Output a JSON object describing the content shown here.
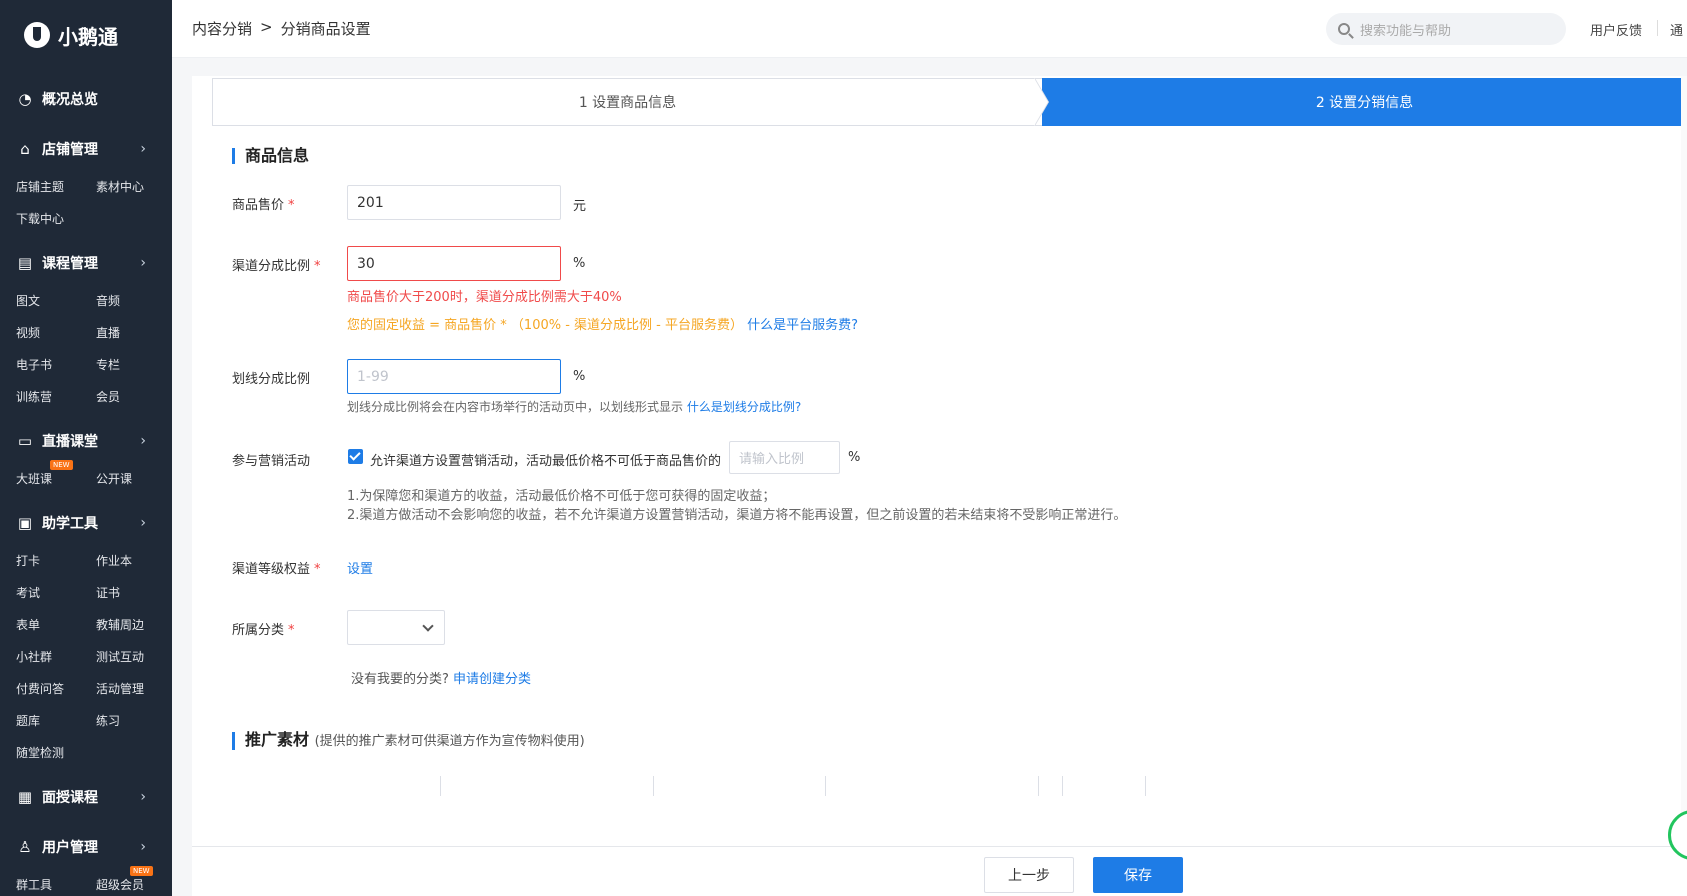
{
  "app": {
    "name": "小鹅通"
  },
  "sidebar": {
    "groups": [
      {
        "label": "概况总览",
        "icon": "pie-chart-icon",
        "items": []
      },
      {
        "label": "店铺管理",
        "icon": "store-icon",
        "items": [
          {
            "label": "店铺主题"
          },
          {
            "label": "素材中心"
          },
          {
            "label": "下载中心"
          }
        ]
      },
      {
        "label": "课程管理",
        "icon": "document-icon",
        "items": [
          {
            "label": "图文"
          },
          {
            "label": "音频"
          },
          {
            "label": "视频"
          },
          {
            "label": "直播"
          },
          {
            "label": "电子书"
          },
          {
            "label": "专栏"
          },
          {
            "label": "训练营"
          },
          {
            "label": "会员"
          }
        ]
      },
      {
        "label": "直播课堂",
        "icon": "video-icon",
        "items": [
          {
            "label": "大班课",
            "badge": "NEW"
          },
          {
            "label": "公开课"
          }
        ]
      },
      {
        "label": "助学工具",
        "icon": "toolbox-icon",
        "items": [
          {
            "label": "打卡"
          },
          {
            "label": "作业本"
          },
          {
            "label": "考试"
          },
          {
            "label": "证书"
          },
          {
            "label": "表单"
          },
          {
            "label": "教辅周边"
          },
          {
            "label": "小社群"
          },
          {
            "label": "测试互动"
          },
          {
            "label": "付费问答"
          },
          {
            "label": "活动管理"
          },
          {
            "label": "题库"
          },
          {
            "label": "练习"
          },
          {
            "label": "随堂检测"
          }
        ]
      },
      {
        "label": "面授课程",
        "icon": "classroom-icon",
        "items": []
      },
      {
        "label": "用户管理",
        "icon": "user-icon",
        "items": [
          {
            "label": "群工具"
          },
          {
            "label": "超级会员",
            "badge": "NEW"
          }
        ]
      }
    ]
  },
  "topbar": {
    "breadcrumb": [
      "内容分销",
      ">",
      "分销商品设置"
    ],
    "search_placeholder": "搜索功能与帮助",
    "feedback": "用户反馈",
    "more": "通"
  },
  "steps": [
    {
      "label": "1 设置商品信息",
      "active": false
    },
    {
      "label": "2 设置分销信息",
      "active": true
    }
  ],
  "section_goods": {
    "title": "商品信息"
  },
  "form": {
    "price": {
      "label": "商品售价",
      "value": "201",
      "unit": "元"
    },
    "ratio": {
      "label": "渠道分成比例",
      "value": "30",
      "unit": "%",
      "error": "商品售价大于200时，渠道分成比例需大于40%",
      "tip": "您的固定收益 = 商品售价 * （100% - 渠道分成比例 - 平台服务费）",
      "tip_link": "什么是平台服务费?"
    },
    "strike": {
      "label": "划线分成比例",
      "placeholder": "1-99",
      "unit": "%",
      "help": "划线分成比例将会在内容市场举行的活动页中，以划线形式显示",
      "help_link": "什么是划线分成比例?"
    },
    "marketing": {
      "label": "参与营销活动",
      "checkbox_label": "允许渠道方设置营销活动，活动最低价格不可低于商品售价的",
      "placeholder": "请输入比例",
      "unit": "%",
      "note1": "1.为保障您和渠道方的收益，活动最低价格不可低于您可获得的固定收益；",
      "note2": "2.渠道方做活动不会影响您的收益，若不允许渠道方设置营销活动，渠道方将不能再设置，但之前设置的若未结束将不受影响正常进行。"
    },
    "level": {
      "label": "渠道等级权益",
      "action": "设置"
    },
    "category": {
      "label": "所属分类",
      "value": "",
      "hint": "没有我要的分类?",
      "hint_link": "申请创建分类"
    }
  },
  "section_promo": {
    "title": "推广素材",
    "note": "(提供的推广素材可供渠道方作为宣传物料使用)"
  },
  "footer": {
    "prev": "上一步",
    "save": "保存"
  },
  "colors": {
    "primary": "#1e7ce6",
    "error": "#f04a4a",
    "warning": "#f5a623",
    "sidebar": "#1f2937"
  }
}
